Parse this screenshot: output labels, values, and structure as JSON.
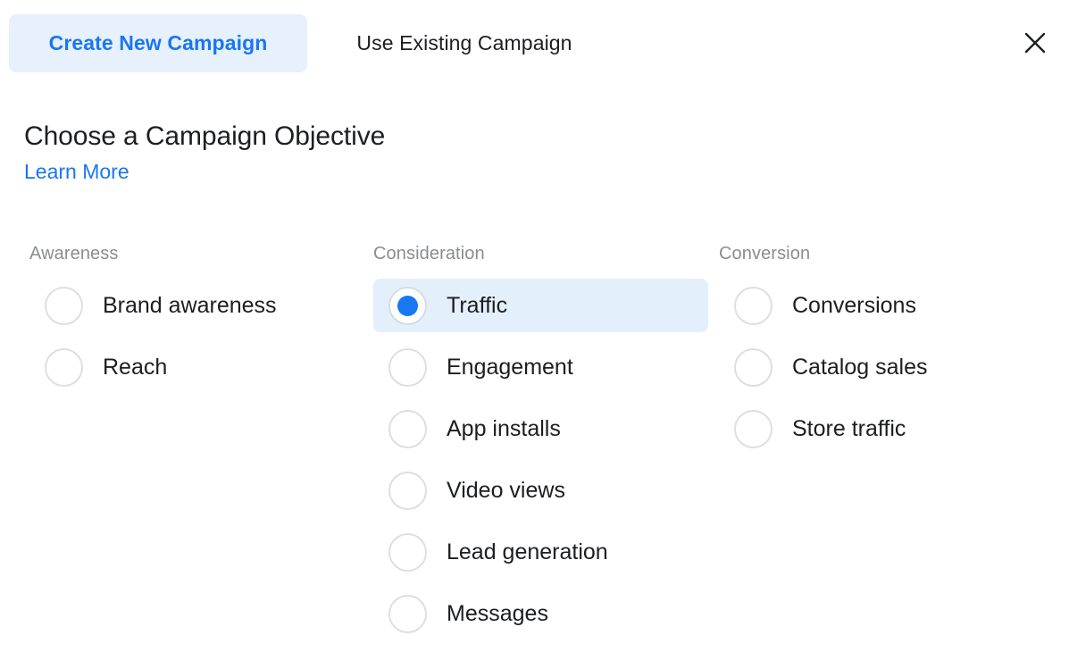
{
  "tabs": [
    {
      "label": "Create New Campaign",
      "active": true,
      "name": "tab-create-new-campaign"
    },
    {
      "label": "Use Existing Campaign",
      "active": false,
      "name": "tab-use-existing-campaign"
    }
  ],
  "close_label": "Close",
  "header": {
    "title": "Choose a Campaign Objective",
    "learn_more": "Learn More"
  },
  "colors": {
    "accent_blue": "#1877f2",
    "tab_active_bg": "#e7f0fd",
    "selected_row_bg": "#e3f0fc",
    "category_label": "#8a8d91",
    "text_primary": "#1c1e21",
    "radio_border": "#dcdfe3"
  },
  "selected_objective": "Traffic",
  "columns": [
    {
      "category": "Awareness",
      "options": [
        {
          "label": "Brand awareness",
          "selected": false
        },
        {
          "label": "Reach",
          "selected": false
        }
      ]
    },
    {
      "category": "Consideration",
      "options": [
        {
          "label": "Traffic",
          "selected": true
        },
        {
          "label": "Engagement",
          "selected": false
        },
        {
          "label": "App installs",
          "selected": false
        },
        {
          "label": "Video views",
          "selected": false
        },
        {
          "label": "Lead generation",
          "selected": false
        },
        {
          "label": "Messages",
          "selected": false
        }
      ]
    },
    {
      "category": "Conversion",
      "options": [
        {
          "label": "Conversions",
          "selected": false
        },
        {
          "label": "Catalog sales",
          "selected": false
        },
        {
          "label": "Store traffic",
          "selected": false
        }
      ]
    }
  ]
}
